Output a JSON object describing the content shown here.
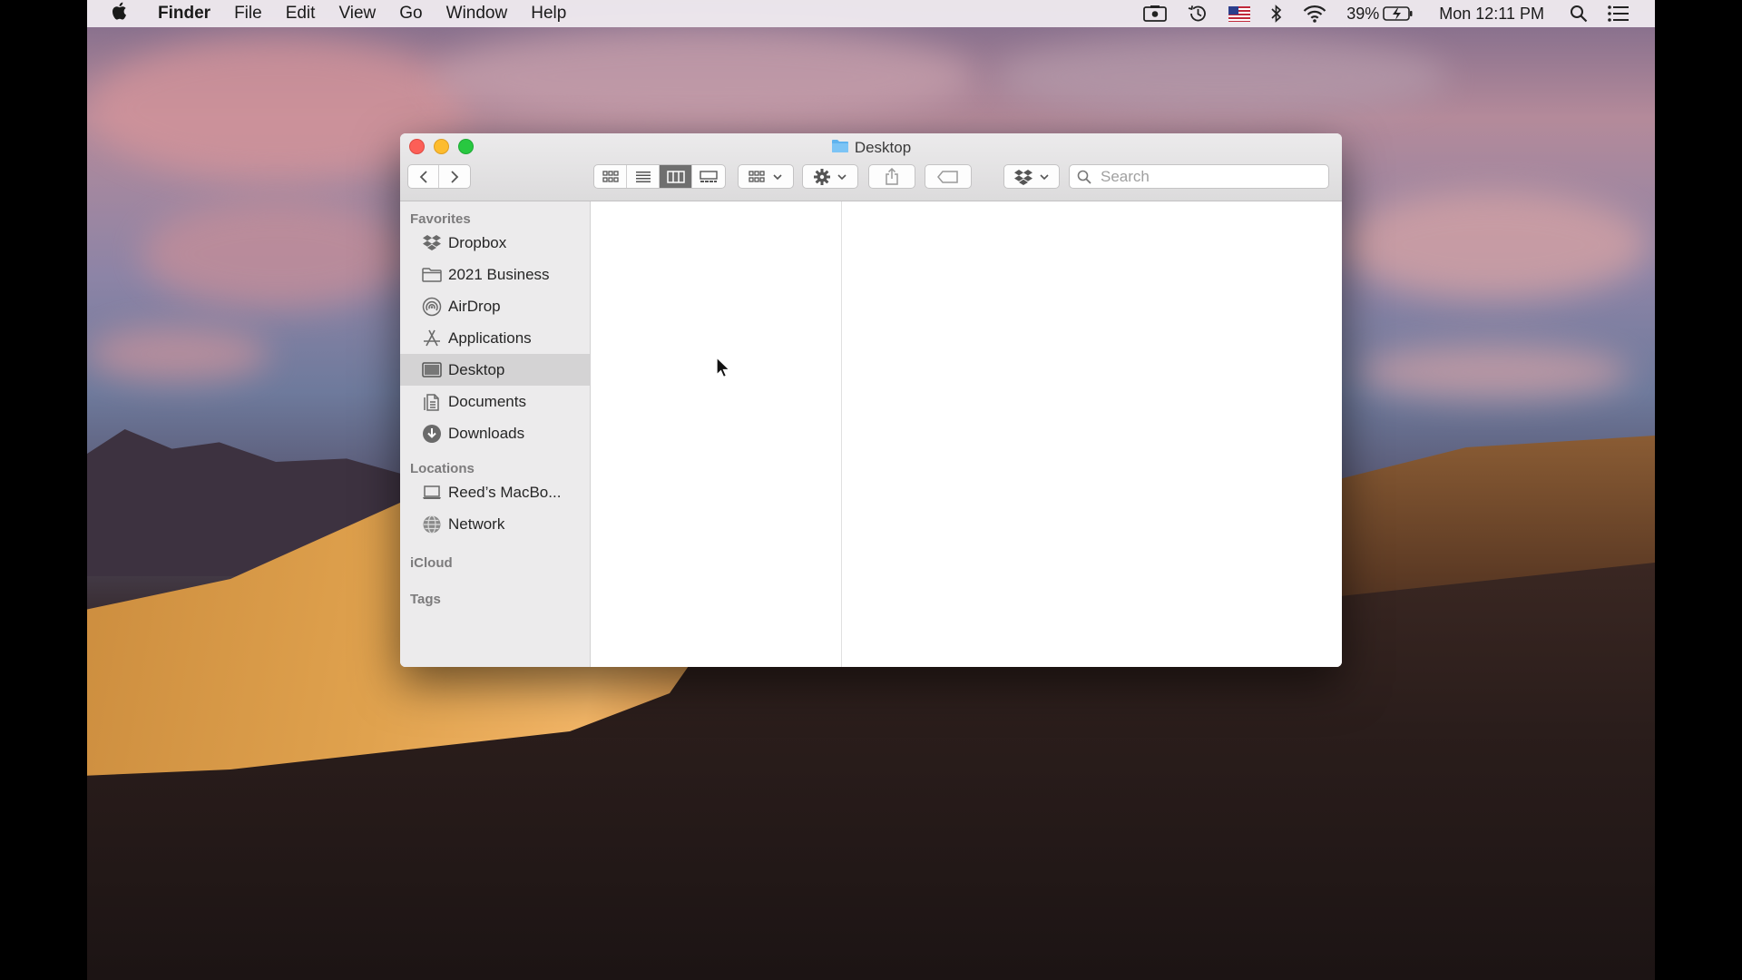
{
  "menubar": {
    "apple_icon": "apple-icon",
    "app_name": "Finder",
    "menus": [
      "File",
      "Edit",
      "View",
      "Go",
      "Window",
      "Help"
    ],
    "battery": "39%",
    "clock": "Mon 12:11 PM"
  },
  "window": {
    "title": "Desktop",
    "search_placeholder": "Search"
  },
  "sidebar": {
    "favorites_heading": "Favorites",
    "favorites": [
      {
        "label": "Dropbox",
        "icon": "dropbox-icon"
      },
      {
        "label": "2021 Business",
        "icon": "folder-icon"
      },
      {
        "label": "AirDrop",
        "icon": "airdrop-icon"
      },
      {
        "label": "Applications",
        "icon": "applications-icon"
      },
      {
        "label": "Desktop",
        "icon": "desktop-icon",
        "selected": true
      },
      {
        "label": "Documents",
        "icon": "documents-icon"
      },
      {
        "label": "Downloads",
        "icon": "downloads-icon"
      }
    ],
    "locations_heading": "Locations",
    "locations": [
      {
        "label": "Reed’s MacBo...",
        "icon": "laptop-icon"
      },
      {
        "label": "Network",
        "icon": "network-icon"
      }
    ],
    "icloud_heading": "iCloud",
    "tags_heading": "Tags"
  },
  "colors": {
    "close": "#fc5f57",
    "minimize": "#fdbc2e",
    "zoom": "#28c840",
    "sidebar_bg": "#ecebec",
    "selected_bg": "#d4d3d4"
  }
}
